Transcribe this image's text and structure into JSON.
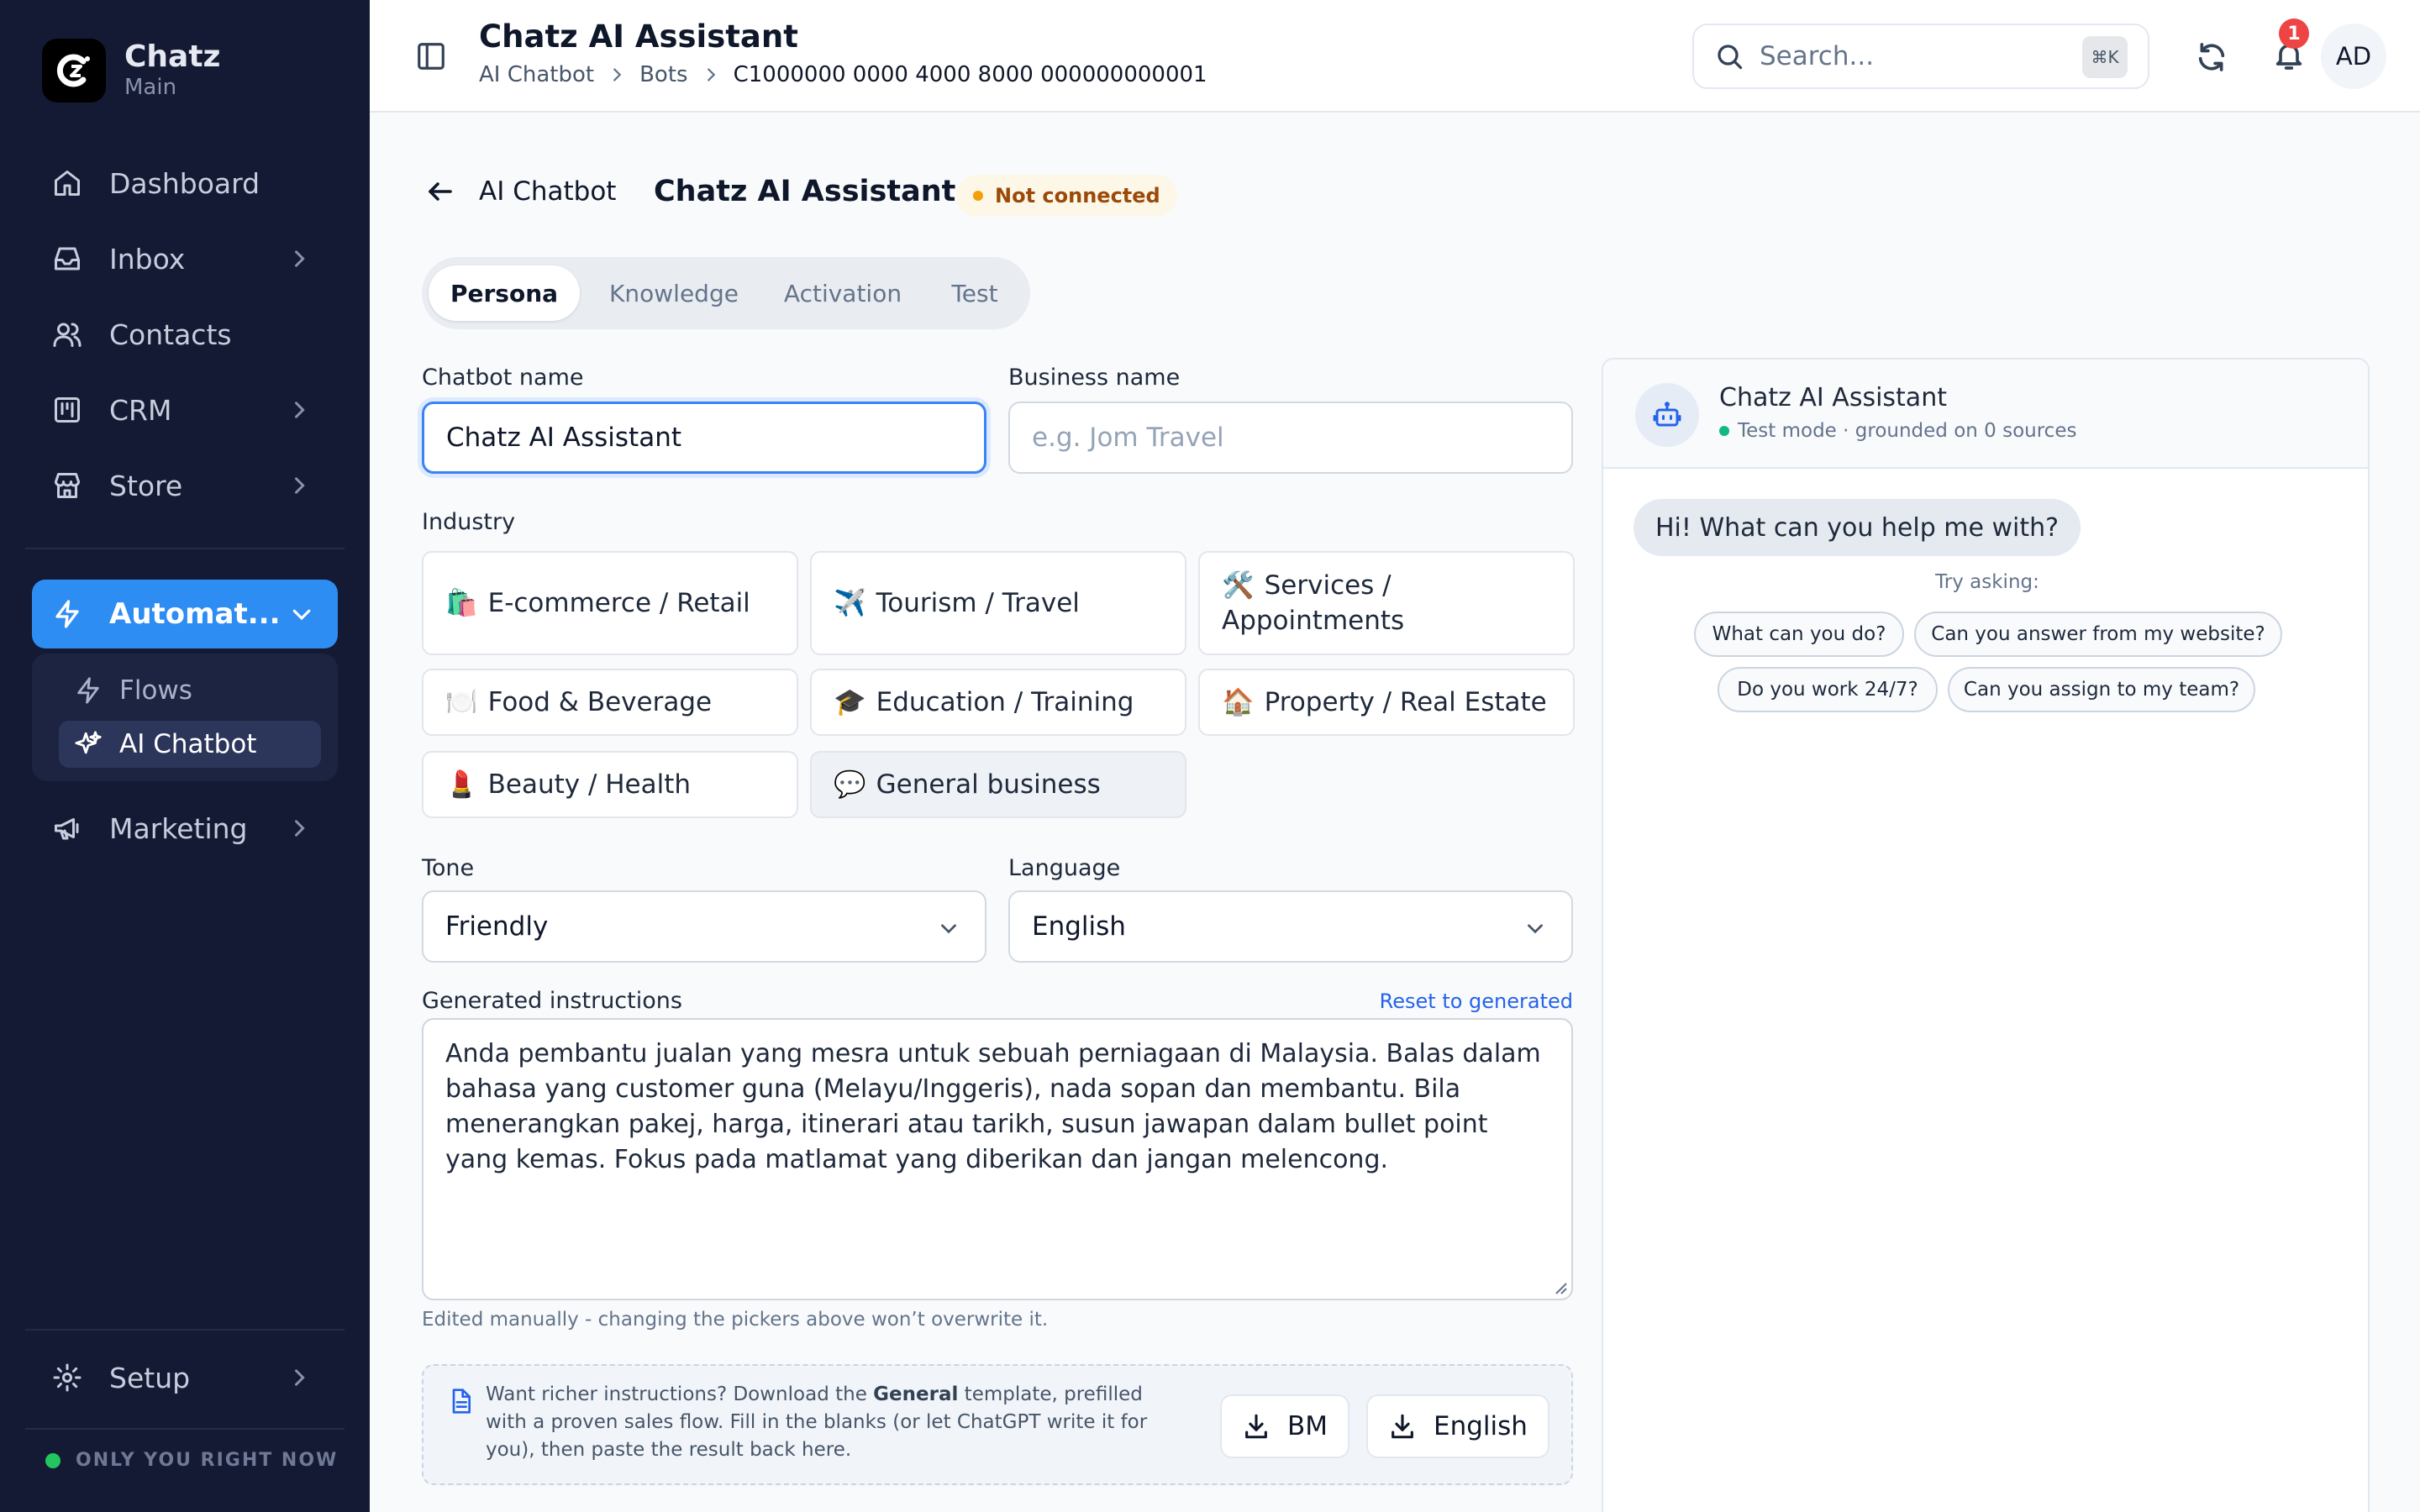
{
  "brand": {
    "name": "Chatz",
    "workspace": "Main"
  },
  "sidebar": {
    "items": [
      {
        "label": "Dashboard",
        "icon": "home-icon"
      },
      {
        "label": "Inbox",
        "icon": "inbox-icon"
      },
      {
        "label": "Contacts",
        "icon": "users-icon"
      },
      {
        "label": "CRM",
        "icon": "kanban-icon"
      },
      {
        "label": "Store",
        "icon": "store-icon"
      }
    ],
    "active": {
      "label": "Automat...",
      "icon": "bolt-icon"
    },
    "sub_items": [
      {
        "label": "Flows",
        "icon": "bolt-icon"
      },
      {
        "label": "AI Chatbot",
        "icon": "sparkles-icon"
      }
    ],
    "marketing": "Marketing",
    "setup": "Setup",
    "status": "ONLY YOU RIGHT NOW"
  },
  "topbar": {
    "title": "Chatz AI Assistant",
    "breadcrumb": [
      "AI Chatbot",
      "Bots",
      "C1000000 0000 4000 8000 000000000001"
    ],
    "search_placeholder": "Search...",
    "shortcut": "⌘K",
    "notification_count": "1",
    "avatar_initials": "AD"
  },
  "header": {
    "back_label": "AI Chatbot",
    "title": "Chatz AI Assistant",
    "status": "Not connected"
  },
  "tabs": [
    "Persona",
    "Knowledge",
    "Activation",
    "Test"
  ],
  "form": {
    "chatbot_name_label": "Chatbot name",
    "chatbot_name_value": "Chatz AI Assistant",
    "business_name_label": "Business name",
    "business_name_placeholder": "e.g. Jom Travel",
    "industry_label": "Industry",
    "industries": [
      {
        "emoji": "🛍️",
        "label": "E-commerce / Retail"
      },
      {
        "emoji": "✈️",
        "label": "Tourism / Travel"
      },
      {
        "emoji": "🛠️",
        "label": "Services / Appointments"
      },
      {
        "emoji": "🍽️",
        "label": "Food & Beverage"
      },
      {
        "emoji": "🎓",
        "label": "Education / Training"
      },
      {
        "emoji": "🏠",
        "label": "Property / Real Estate"
      },
      {
        "emoji": "💄",
        "label": "Beauty / Health"
      },
      {
        "emoji": "💬",
        "label": "General business"
      }
    ],
    "selected_industry": "General business",
    "tone_label": "Tone",
    "tone_value": "Friendly",
    "language_label": "Language",
    "language_value": "English",
    "instructions_label": "Generated instructions",
    "reset_label": "Reset to generated",
    "instructions_value": "Anda pembantu jualan yang mesra untuk sebuah perniagaan di Malaysia. Balas dalam bahasa yang customer guna (Melayu/Inggeris), nada sopan dan membantu. Bila menerangkan pakej, harga, itinerari atau tarikh, susun jawapan dalam bullet point yang kemas. Fokus pada matlamat yang diberikan dan jangan melencong.",
    "helper": "Edited manually - changing the pickers above won’t overwrite it."
  },
  "template": {
    "text_before": "Want richer instructions? Download the ",
    "template_name": "General",
    "text_after": " template, prefilled with a proven sales flow. Fill in the blanks (or let ChatGPT write it for you), then paste the result back here.",
    "button_bm": "BM",
    "button_en": "English"
  },
  "preview": {
    "name": "Chatz AI Assistant",
    "subtitle": "Test mode · grounded on 0 sources",
    "greeting": "Hi! What can you help me with?",
    "try_label": "Try asking:",
    "suggestions": [
      "What can you do?",
      "Can you answer from my website?",
      "Do you work 24/7?",
      "Can you assign to my team?"
    ]
  },
  "colors": {
    "sidebar_bg": "#141a33",
    "accent": "#2d8df2",
    "status_warning": "#f59e0b",
    "status_online": "#22c55e"
  }
}
